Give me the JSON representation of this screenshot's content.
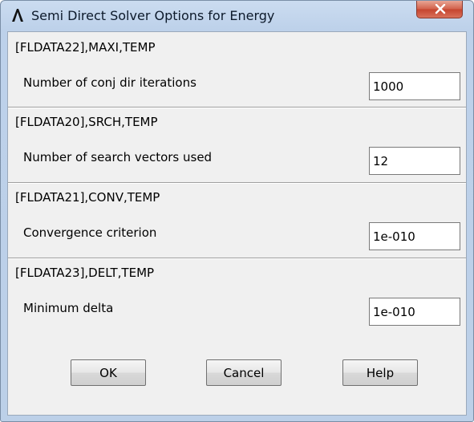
{
  "window": {
    "title": "Semi Direct Solver Options for Energy"
  },
  "sections": [
    {
      "command": "[FLDATA22],MAXI,TEMP",
      "label": "Number of conj dir iterations",
      "value": "1000"
    },
    {
      "command": "[FLDATA20],SRCH,TEMP",
      "label": "Number of search vectors used",
      "value": "12"
    },
    {
      "command": "[FLDATA21],CONV,TEMP",
      "label": "Convergence criterion",
      "value": "1e-010"
    },
    {
      "command": "[FLDATA23],DELT,TEMP",
      "label": "Minimum delta",
      "value": "1e-010"
    }
  ],
  "buttons": {
    "ok": "OK",
    "cancel": "Cancel",
    "help": "Help"
  },
  "icons": {
    "app": "ansys-lambda-icon",
    "close": "close-icon"
  }
}
